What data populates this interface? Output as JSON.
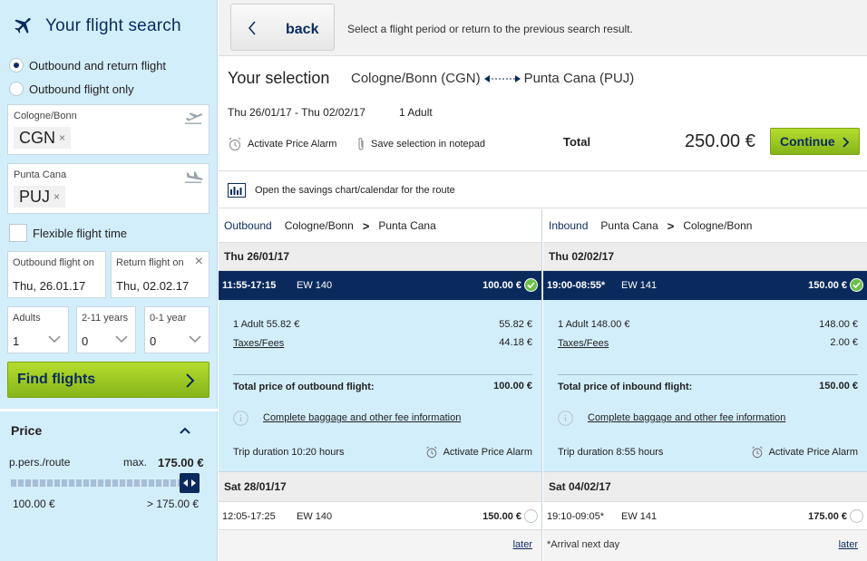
{
  "sidebar": {
    "title": "Your flight search",
    "trip_options": [
      {
        "label": "Outbound and return flight",
        "selected": true
      },
      {
        "label": "Outbound flight only",
        "selected": false
      }
    ],
    "origin": {
      "label": "Cologne/Bonn",
      "code": "CGN",
      "remove": "×"
    },
    "destination": {
      "label": "Punta Cana",
      "code": "PUJ",
      "remove": "×"
    },
    "flexible_label": "Flexible flight time",
    "outbound_date": {
      "label": "Outbound flight on",
      "value": "Thu, 26.01.17"
    },
    "return_date": {
      "label": "Return flight on",
      "value": "Thu, 02.02.17",
      "clear": "×"
    },
    "passengers": [
      {
        "label": "Adults",
        "value": "1"
      },
      {
        "label": "2-11 years",
        "value": "0"
      },
      {
        "label": "0-1 year",
        "value": "0"
      }
    ],
    "find_button": "Find flights",
    "price": {
      "heading": "Price",
      "per_route": "p.pers./route",
      "max_label": "max.",
      "max_value": "175.00 €",
      "range_min": "100.00 €",
      "range_max": "> 175.00 €",
      "slider_fraction": 1.0
    }
  },
  "topbar": {
    "back_label": "back",
    "hint": "Select a flight period or return to the previous search result."
  },
  "selection": {
    "title": "Your selection",
    "origin": "Cologne/Bonn (CGN)",
    "destination": "Punta Cana (PUJ)",
    "dates": "Thu 26/01/17 - Thu 02/02/17",
    "pax": "1 Adult",
    "alarm": "Activate Price Alarm",
    "notepad": "Save selection in notepad",
    "total_label": "Total",
    "total_value": "250.00 €",
    "continue_label": "Continue"
  },
  "savings_link": "Open the savings chart/calendar for the route",
  "outbound": {
    "dir": "Outbound",
    "from": "Cologne/Bonn",
    "to": "Punta Cana",
    "arrow": ">",
    "day1": "Thu 26/01/17",
    "selected": {
      "time": "11:55-17:15",
      "flight": "EW 140",
      "price": "100.00 €"
    },
    "details": {
      "adult": "1 Adult 55.82 €",
      "adult_value": "55.82 €",
      "taxes": "Taxes/Fees",
      "taxes_value": "44.18 €",
      "total_label": "Total price of outbound flight:",
      "total_value": "100.00 €",
      "baggage": "Complete baggage and other fee information",
      "duration": "Trip duration 10:20  hours",
      "alarm": "Activate Price Alarm"
    },
    "day2": "Sat 28/01/17",
    "alt": {
      "time": "12:05-17:25",
      "flight": "EW 140",
      "price": "150.00 €"
    },
    "later": "later"
  },
  "inbound": {
    "dir": "Inbound",
    "from": "Punta Cana",
    "to": "Cologne/Bonn",
    "arrow": ">",
    "day1": "Thu 02/02/17",
    "selected": {
      "time": "19:00-08:55*",
      "flight": "EW 141",
      "price": "150.00 €"
    },
    "details": {
      "adult": "1 Adult 148.00 €",
      "adult_value": "148.00 €",
      "taxes": "Taxes/Fees",
      "taxes_value": "2.00 €",
      "total_label": "Total price of inbound flight:",
      "total_value": "150.00 €",
      "baggage": "Complete baggage and other fee information",
      "duration": "Trip duration 8:55  hours",
      "alarm": "Activate Price Alarm"
    },
    "day2": "Sat 04/02/17",
    "alt": {
      "time": "19:10-09:05*",
      "flight": "EW 141",
      "price": "175.00 €"
    },
    "note": "*Arrival next day",
    "later": "later"
  },
  "colors": {
    "navy": "#0a2a5e",
    "light_blue": "#d3eefb",
    "green": "#9ccb22",
    "check_green": "#6cc04a"
  }
}
